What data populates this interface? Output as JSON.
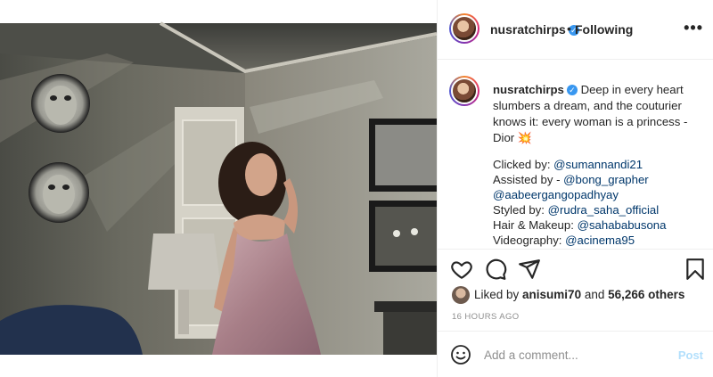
{
  "post": {
    "username": "nusratchirps",
    "follow_status": "Following",
    "separator": "•",
    "more_label": "•••",
    "verified_glyph": "✓"
  },
  "caption": {
    "username": "nusratchirps",
    "text": "Deep in every heart slumbers a dream, and the couturier knows it: every woman is a princess - Dior",
    "emoji": "💥",
    "credits": [
      {
        "label": "Clicked by: ",
        "mention": "@sumannandi21"
      },
      {
        "label": "Assisted by - ",
        "mention": "@bong_grapher"
      },
      {
        "label": "",
        "mention": "@aabeergangopadhyay"
      },
      {
        "label": "Styled by: ",
        "mention": "@rudra_saha_official"
      },
      {
        "label": "Hair & Makeup: ",
        "mention": "@sahababusona"
      },
      {
        "label": "Videography: ",
        "mention": "@acinema95"
      }
    ]
  },
  "actions": {
    "like_icon": "heart-icon",
    "comment_icon": "comment-icon",
    "share_icon": "share-icon",
    "save_icon": "bookmark-icon"
  },
  "likes": {
    "prefix": "Liked by ",
    "user": "anisumi70",
    "middle": " and ",
    "count": "56,266 others"
  },
  "timestamp": "16 HOURS AGO",
  "comment": {
    "placeholder": "Add a comment...",
    "post_label": "Post"
  },
  "colors": {
    "link": "#00376b",
    "verified": "#3897f0",
    "post_button": "#b2dffc",
    "muted": "#8e8e8e"
  }
}
